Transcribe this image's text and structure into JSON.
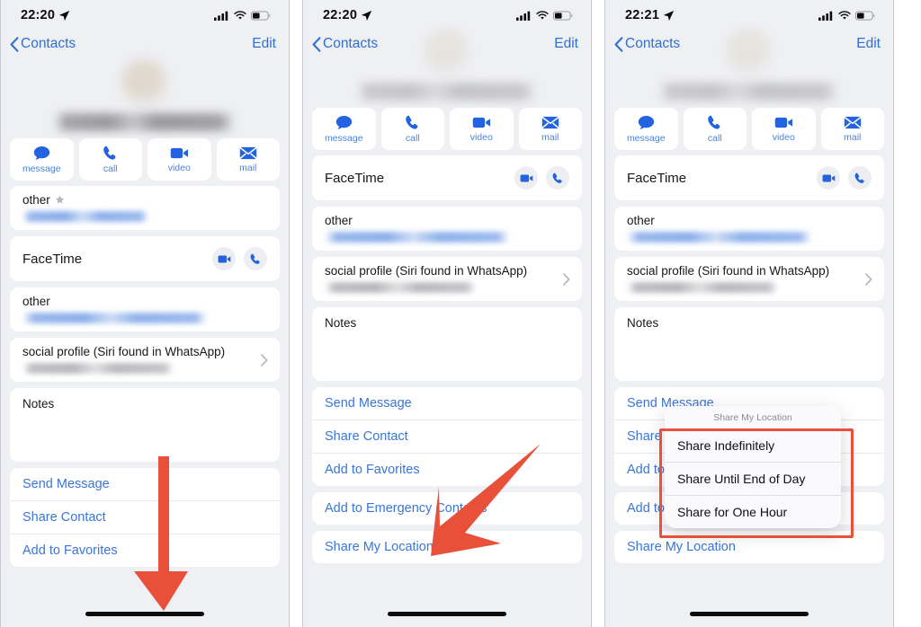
{
  "panels": [
    {
      "id": "panel-1",
      "status": {
        "time": "22:20",
        "location_icon": "location-arrow-icon",
        "signal_icon": "cellular-signal-icon",
        "wifi_icon": "wifi-icon",
        "battery_icon": "battery-icon"
      },
      "nav": {
        "back_label": "Contacts",
        "edit_label": "Edit"
      },
      "actions": [
        {
          "icon": "message-bubble-icon",
          "label": "message"
        },
        {
          "icon": "phone-handset-icon",
          "label": "call"
        },
        {
          "icon": "video-camera-icon",
          "label": "video"
        },
        {
          "icon": "envelope-icon",
          "label": "mail"
        }
      ],
      "fields": {
        "phone_label": "other",
        "facetime_label": "FaceTime",
        "email_label": "other",
        "social_label": "social profile (Siri found in WhatsApp)",
        "notes_label": "Notes"
      },
      "links": [
        "Send Message",
        "Share Contact",
        "Add to Favorites"
      ],
      "annotation": {
        "type": "down-arrow",
        "color": "#e8503a"
      }
    },
    {
      "id": "panel-2",
      "status": {
        "time": "22:20",
        "location_icon": "location-arrow-icon",
        "signal_icon": "cellular-signal-icon",
        "wifi_icon": "wifi-icon",
        "battery_icon": "battery-icon"
      },
      "nav": {
        "back_label": "Contacts",
        "edit_label": "Edit"
      },
      "actions": [
        {
          "icon": "message-bubble-icon",
          "label": "message"
        },
        {
          "icon": "phone-handset-icon",
          "label": "call"
        },
        {
          "icon": "video-camera-icon",
          "label": "video"
        },
        {
          "icon": "envelope-icon",
          "label": "mail"
        }
      ],
      "fields": {
        "facetime_label": "FaceTime",
        "email_label": "other",
        "social_label": "social profile (Siri found in WhatsApp)",
        "notes_label": "Notes"
      },
      "links": [
        "Send Message",
        "Share Contact",
        "Add to Favorites"
      ],
      "links2": [
        "Add to Emergency Contacts"
      ],
      "links3": [
        "Share My Location"
      ],
      "annotation": {
        "type": "diagonal-arrow",
        "color": "#e8503a"
      }
    },
    {
      "id": "panel-3",
      "status": {
        "time": "22:21",
        "location_icon": "location-arrow-icon",
        "signal_icon": "cellular-signal-icon",
        "wifi_icon": "wifi-icon",
        "battery_icon": "battery-icon"
      },
      "nav": {
        "back_label": "Contacts",
        "edit_label": "Edit"
      },
      "actions": [
        {
          "icon": "message-bubble-icon",
          "label": "message"
        },
        {
          "icon": "phone-handset-icon",
          "label": "call"
        },
        {
          "icon": "video-camera-icon",
          "label": "video"
        },
        {
          "icon": "envelope-icon",
          "label": "mail"
        }
      ],
      "fields": {
        "facetime_label": "FaceTime",
        "email_label": "other",
        "social_label": "social profile (Siri found in WhatsApp)",
        "notes_label": "Notes"
      },
      "links": [
        "Send Message",
        "Share",
        "Add to"
      ],
      "links2": [
        "Add to"
      ],
      "links3": [
        "Share My Location"
      ],
      "popup": {
        "title": "Share My Location",
        "items": [
          "Share Indefinitely",
          "Share Until End of Day",
          "Share for One Hour"
        ]
      },
      "annotation": {
        "type": "highlight-rect",
        "color": "#e8503a"
      }
    }
  ],
  "colors": {
    "ios_blue": "#3a76d8",
    "annotation_red": "#e8503a",
    "panel_bg": "#eff0f4",
    "card_bg": "#ffffff"
  }
}
